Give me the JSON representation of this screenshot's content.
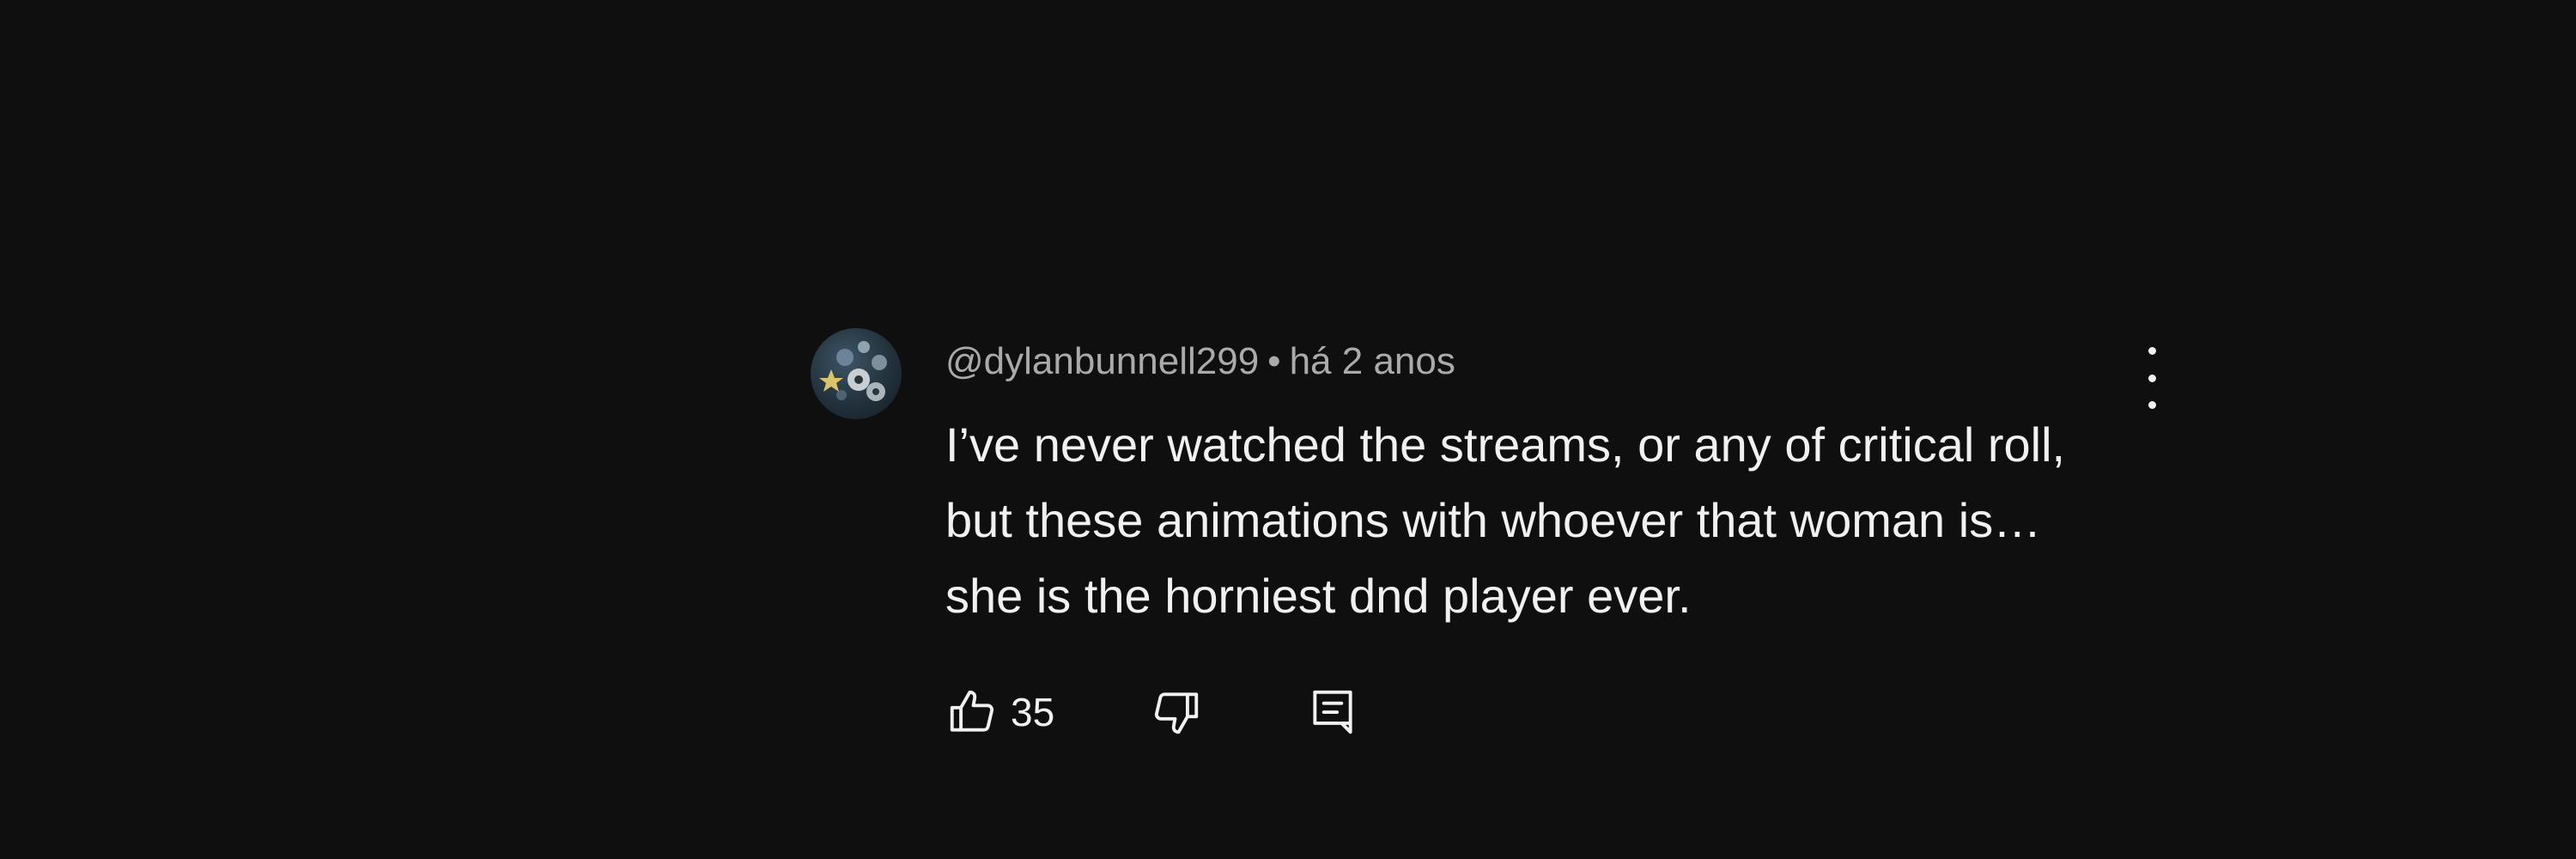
{
  "comment": {
    "author": "@dylanbunnell299",
    "separator": "•",
    "time": "há 2 anos",
    "text": "I’ve never watched the streams, or any of critical roll, but these animations with whoever that woman is…she is the horniest dnd player ever.",
    "like_count": "35"
  },
  "icons": {
    "menu": "more-vert-icon",
    "like": "thumbs-up-icon",
    "dislike": "thumbs-down-icon",
    "reply": "comment-reply-icon"
  },
  "colors": {
    "background": "#0f0f0f",
    "text_primary": "#f1f1f1",
    "text_secondary": "#aaaaaa"
  }
}
